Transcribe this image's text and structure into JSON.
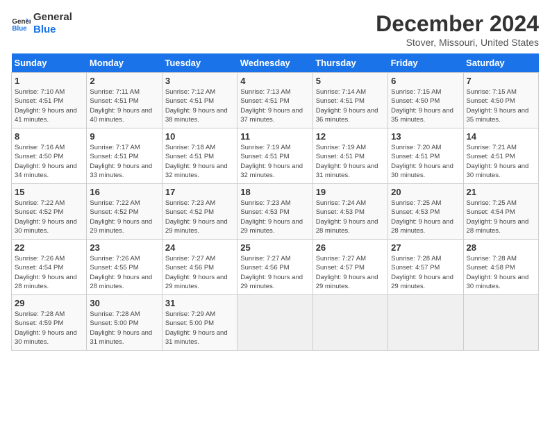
{
  "logo": {
    "text_general": "General",
    "text_blue": "Blue"
  },
  "header": {
    "title": "December 2024",
    "subtitle": "Stover, Missouri, United States"
  },
  "weekdays": [
    "Sunday",
    "Monday",
    "Tuesday",
    "Wednesday",
    "Thursday",
    "Friday",
    "Saturday"
  ],
  "weeks": [
    [
      {
        "day": "1",
        "sunrise": "7:10 AM",
        "sunset": "4:51 PM",
        "daylight": "9 hours and 41 minutes."
      },
      {
        "day": "2",
        "sunrise": "7:11 AM",
        "sunset": "4:51 PM",
        "daylight": "9 hours and 40 minutes."
      },
      {
        "day": "3",
        "sunrise": "7:12 AM",
        "sunset": "4:51 PM",
        "daylight": "9 hours and 38 minutes."
      },
      {
        "day": "4",
        "sunrise": "7:13 AM",
        "sunset": "4:51 PM",
        "daylight": "9 hours and 37 minutes."
      },
      {
        "day": "5",
        "sunrise": "7:14 AM",
        "sunset": "4:51 PM",
        "daylight": "9 hours and 36 minutes."
      },
      {
        "day": "6",
        "sunrise": "7:15 AM",
        "sunset": "4:50 PM",
        "daylight": "9 hours and 35 minutes."
      },
      {
        "day": "7",
        "sunrise": "7:15 AM",
        "sunset": "4:50 PM",
        "daylight": "9 hours and 35 minutes."
      }
    ],
    [
      {
        "day": "8",
        "sunrise": "7:16 AM",
        "sunset": "4:50 PM",
        "daylight": "9 hours and 34 minutes."
      },
      {
        "day": "9",
        "sunrise": "7:17 AM",
        "sunset": "4:51 PM",
        "daylight": "9 hours and 33 minutes."
      },
      {
        "day": "10",
        "sunrise": "7:18 AM",
        "sunset": "4:51 PM",
        "daylight": "9 hours and 32 minutes."
      },
      {
        "day": "11",
        "sunrise": "7:19 AM",
        "sunset": "4:51 PM",
        "daylight": "9 hours and 32 minutes."
      },
      {
        "day": "12",
        "sunrise": "7:19 AM",
        "sunset": "4:51 PM",
        "daylight": "9 hours and 31 minutes."
      },
      {
        "day": "13",
        "sunrise": "7:20 AM",
        "sunset": "4:51 PM",
        "daylight": "9 hours and 30 minutes."
      },
      {
        "day": "14",
        "sunrise": "7:21 AM",
        "sunset": "4:51 PM",
        "daylight": "9 hours and 30 minutes."
      }
    ],
    [
      {
        "day": "15",
        "sunrise": "7:22 AM",
        "sunset": "4:52 PM",
        "daylight": "9 hours and 30 minutes."
      },
      {
        "day": "16",
        "sunrise": "7:22 AM",
        "sunset": "4:52 PM",
        "daylight": "9 hours and 29 minutes."
      },
      {
        "day": "17",
        "sunrise": "7:23 AM",
        "sunset": "4:52 PM",
        "daylight": "9 hours and 29 minutes."
      },
      {
        "day": "18",
        "sunrise": "7:23 AM",
        "sunset": "4:53 PM",
        "daylight": "9 hours and 29 minutes."
      },
      {
        "day": "19",
        "sunrise": "7:24 AM",
        "sunset": "4:53 PM",
        "daylight": "9 hours and 28 minutes."
      },
      {
        "day": "20",
        "sunrise": "7:25 AM",
        "sunset": "4:53 PM",
        "daylight": "9 hours and 28 minutes."
      },
      {
        "day": "21",
        "sunrise": "7:25 AM",
        "sunset": "4:54 PM",
        "daylight": "9 hours and 28 minutes."
      }
    ],
    [
      {
        "day": "22",
        "sunrise": "7:26 AM",
        "sunset": "4:54 PM",
        "daylight": "9 hours and 28 minutes."
      },
      {
        "day": "23",
        "sunrise": "7:26 AM",
        "sunset": "4:55 PM",
        "daylight": "9 hours and 28 minutes."
      },
      {
        "day": "24",
        "sunrise": "7:27 AM",
        "sunset": "4:56 PM",
        "daylight": "9 hours and 29 minutes."
      },
      {
        "day": "25",
        "sunrise": "7:27 AM",
        "sunset": "4:56 PM",
        "daylight": "9 hours and 29 minutes."
      },
      {
        "day": "26",
        "sunrise": "7:27 AM",
        "sunset": "4:57 PM",
        "daylight": "9 hours and 29 minutes."
      },
      {
        "day": "27",
        "sunrise": "7:28 AM",
        "sunset": "4:57 PM",
        "daylight": "9 hours and 29 minutes."
      },
      {
        "day": "28",
        "sunrise": "7:28 AM",
        "sunset": "4:58 PM",
        "daylight": "9 hours and 30 minutes."
      }
    ],
    [
      {
        "day": "29",
        "sunrise": "7:28 AM",
        "sunset": "4:59 PM",
        "daylight": "9 hours and 30 minutes."
      },
      {
        "day": "30",
        "sunrise": "7:28 AM",
        "sunset": "5:00 PM",
        "daylight": "9 hours and 31 minutes."
      },
      {
        "day": "31",
        "sunrise": "7:29 AM",
        "sunset": "5:00 PM",
        "daylight": "9 hours and 31 minutes."
      },
      null,
      null,
      null,
      null
    ]
  ]
}
